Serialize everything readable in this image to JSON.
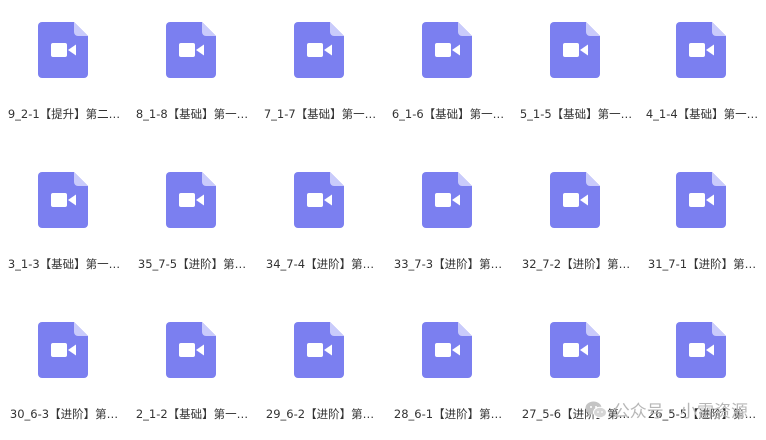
{
  "files": [
    {
      "name": "9_2-1【提升】第二…"
    },
    {
      "name": "8_1-8【基础】第一…"
    },
    {
      "name": "7_1-7【基础】第一…"
    },
    {
      "name": "6_1-6【基础】第一…"
    },
    {
      "name": "5_1-5【基础】第一…"
    },
    {
      "name": "4_1-4【基础】第一…"
    },
    {
      "name": "3_1-3【基础】第一…"
    },
    {
      "name": "35_7-5【进阶】第…"
    },
    {
      "name": "34_7-4【进阶】第…"
    },
    {
      "name": "33_7-3【进阶】第…"
    },
    {
      "name": "32_7-2【进阶】第…"
    },
    {
      "name": "31_7-1【进阶】第…"
    },
    {
      "name": "30_6-3【进阶】第…"
    },
    {
      "name": "2_1-2【基础】第一…"
    },
    {
      "name": "29_6-2【进阶】第…"
    },
    {
      "name": "28_6-1【进阶】第…"
    },
    {
      "name": "27_5-6【进阶】第…"
    },
    {
      "name": "26_5-5【进阶】第…"
    }
  ],
  "icon": "video-file-icon",
  "colors": {
    "icon_body": "#7b7ff0",
    "icon_fold": "#c9cbfb",
    "text": "#333333",
    "watermark": "#b7b7b7"
  },
  "watermark": {
    "text": "公众号 · 小雷资源",
    "icon": "wechat-icon"
  }
}
